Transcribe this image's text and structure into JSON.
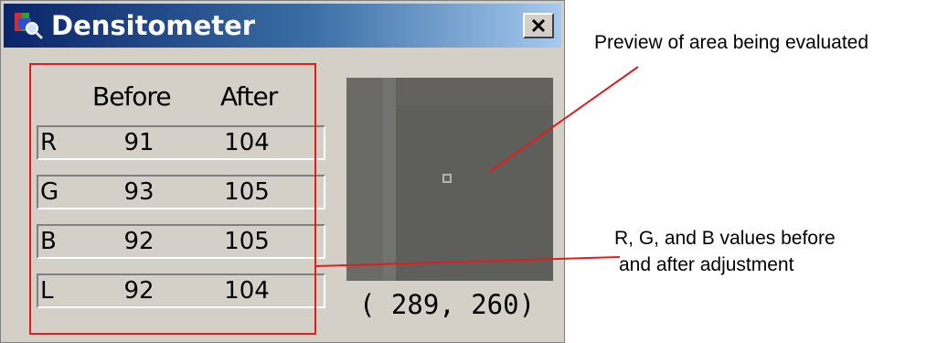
{
  "window": {
    "title": "Densitometer",
    "close_glyph": "✕"
  },
  "table": {
    "headers": {
      "before": "Before",
      "after": "After"
    },
    "rows": [
      {
        "channel": "R",
        "before": "91",
        "after": "104"
      },
      {
        "channel": "G",
        "before": "93",
        "after": "105"
      },
      {
        "channel": "B",
        "before": "92",
        "after": "105"
      },
      {
        "channel": "L",
        "before": "92",
        "after": "104"
      }
    ]
  },
  "preview": {
    "coordinates": "( 289, 260)"
  },
  "annotations": {
    "preview_label": "Preview of area being evaluated",
    "values_label_line1": "R, G, and B values before",
    "values_label_line2": "and after adjustment",
    "color": "#e01e1e"
  }
}
